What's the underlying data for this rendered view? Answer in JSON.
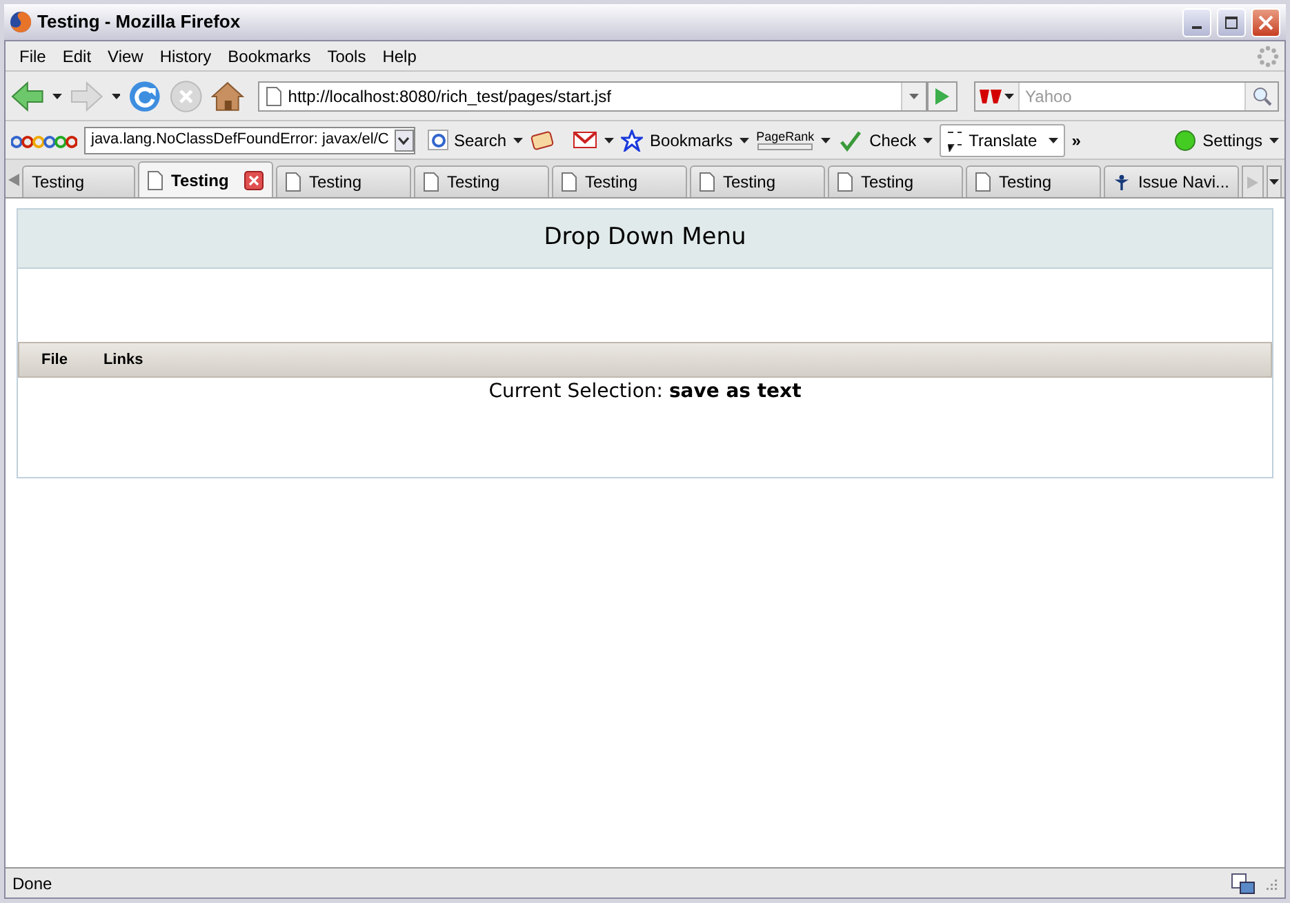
{
  "window": {
    "title": "Testing - Mozilla Firefox"
  },
  "menu": [
    "File",
    "Edit",
    "View",
    "History",
    "Bookmarks",
    "Tools",
    "Help"
  ],
  "navigation": {
    "url": "http://localhost:8080/rich_test/pages/start.jsf",
    "search_placeholder": "Yahoo"
  },
  "google_toolbar": {
    "query": "java.lang.NoClassDefFoundError: javax/el/C",
    "search": "Search",
    "bookmarks": "Bookmarks",
    "pagerank": "PageRank",
    "check": "Check",
    "translate": "Translate",
    "more": "»",
    "settings": "Settings"
  },
  "tabs": [
    {
      "label": "Testing",
      "selected": false,
      "kind": "plain"
    },
    {
      "label": "Testing",
      "selected": true,
      "kind": "page"
    },
    {
      "label": "Testing",
      "selected": false,
      "kind": "page"
    },
    {
      "label": "Testing",
      "selected": false,
      "kind": "page"
    },
    {
      "label": "Testing",
      "selected": false,
      "kind": "page"
    },
    {
      "label": "Testing",
      "selected": false,
      "kind": "page"
    },
    {
      "label": "Testing",
      "selected": false,
      "kind": "page"
    },
    {
      "label": "Testing",
      "selected": false,
      "kind": "page"
    },
    {
      "label": "Issue Navi...",
      "selected": false,
      "kind": "figure"
    }
  ],
  "page": {
    "heading": "Drop Down Menu",
    "menu": [
      "File",
      "Links"
    ],
    "selection_label": "Current Selection:",
    "selection_value": "save as text"
  },
  "status_bar": "Done"
}
